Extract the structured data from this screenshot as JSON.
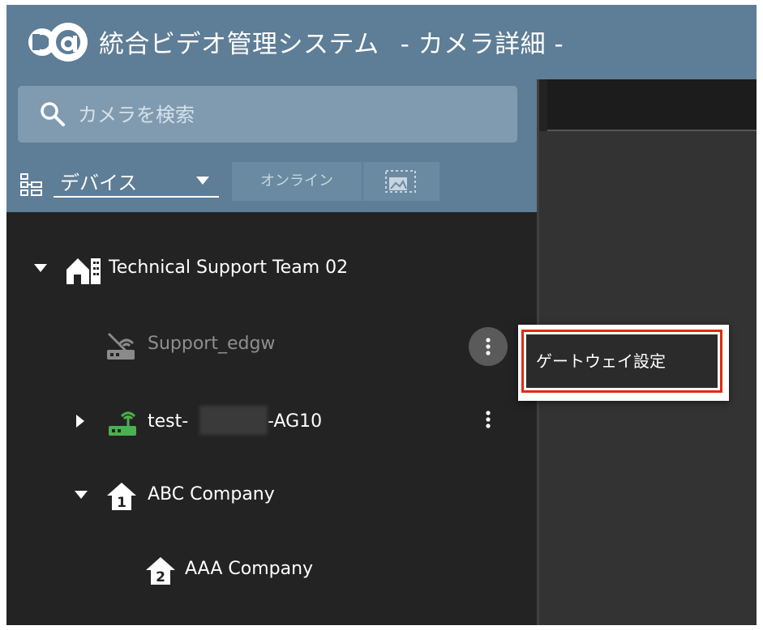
{
  "header": {
    "title": "統合ビデオ管理システム",
    "subtitle": "- カメラ詳細 -",
    "logo_icon": "ab-logo-icon"
  },
  "sidebar": {
    "search": {
      "placeholder": "カメラを検索",
      "icon": "search-icon"
    },
    "view_selector": {
      "label": "デバイス",
      "icon": "device-tree-icon"
    },
    "filters": {
      "online_label": "オンライン",
      "thumbnail_icon": "thumbnail-view-icon"
    }
  },
  "tree": [
    {
      "label": "Technical Support Team 02",
      "icon": "building-icon",
      "expanded": true
    },
    {
      "label": "Support_edgw",
      "icon": "router-offline-icon",
      "status": "offline"
    },
    {
      "label_prefix": "test-",
      "label_suffix": "-AG10",
      "icon": "router-online-icon",
      "expanded": false
    },
    {
      "label": "ABC Company",
      "icon": "home-1-icon",
      "expanded": true
    },
    {
      "label": "AAA Company",
      "icon": "home-2-icon"
    }
  ],
  "context_menu": {
    "items": [
      "ゲートウェイ設定"
    ]
  },
  "colors": {
    "header_bg": "#5e7d96",
    "tree_bg": "#232323",
    "online_icon": "#4caf50",
    "highlight_border": "#e02a10"
  }
}
